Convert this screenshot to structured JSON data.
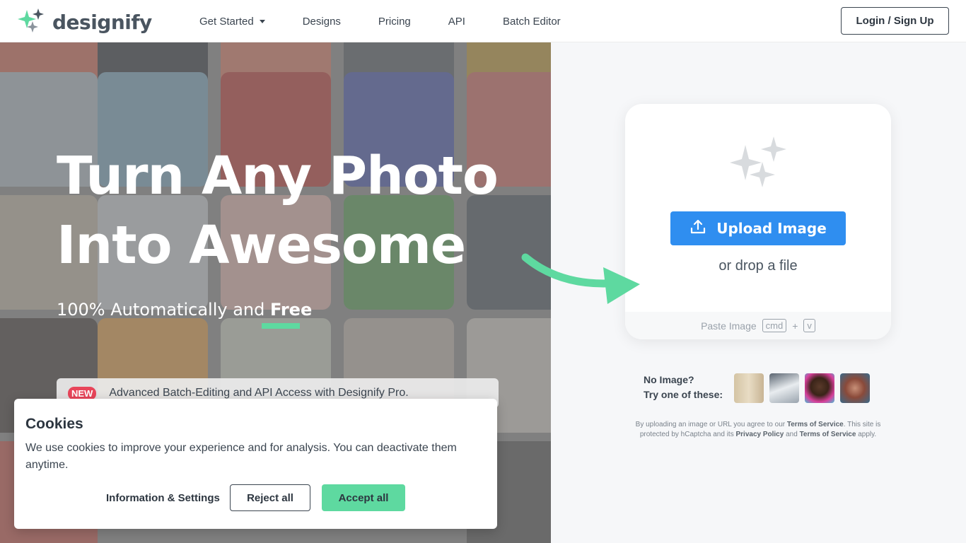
{
  "header": {
    "brand": "designify",
    "nav": [
      {
        "label": "Get Started",
        "has_dropdown": true
      },
      {
        "label": "Designs"
      },
      {
        "label": "Pricing"
      },
      {
        "label": "API"
      },
      {
        "label": "Batch Editor"
      }
    ],
    "login_label": "Login / Sign Up"
  },
  "hero": {
    "title_line1": "Turn Any Photo",
    "title_line2": "Into Awesome",
    "subtitle_prefix": "100% Automatically and ",
    "subtitle_emphasis": "Free",
    "news_badge": "NEW",
    "news_text": "Advanced Batch-Editing and API Access with Designify Pro."
  },
  "upload": {
    "button_label": "Upload Image",
    "drop_text": "or drop a file",
    "paste_label": "Paste Image",
    "key1": "cmd",
    "plus": "+",
    "key2": "v"
  },
  "samples": {
    "label_line1": "No Image?",
    "label_line2": "Try one of these:",
    "items": [
      "paper-cup",
      "white-car",
      "man-portrait",
      "woman-portrait"
    ]
  },
  "terms": {
    "t1": "By uploading an image or URL you agree to our ",
    "tos": "Terms of Service",
    "t2": ". This site is protected by hCaptcha and its ",
    "privacy": "Privacy Policy",
    "t3": " and ",
    "tos2": "Terms of Service",
    "t4": " apply."
  },
  "cookie": {
    "title": "Cookies",
    "text": "We use cookies to improve your experience and for analysis. You can deactivate them anytime.",
    "info_label": "Information & Settings",
    "reject_label": "Reject all",
    "accept_label": "Accept all"
  },
  "colors": {
    "accent_green": "#5ed9a0",
    "upload_blue": "#2f8ef0",
    "badge_red": "#e8455a",
    "text_dark": "#3b4550"
  }
}
